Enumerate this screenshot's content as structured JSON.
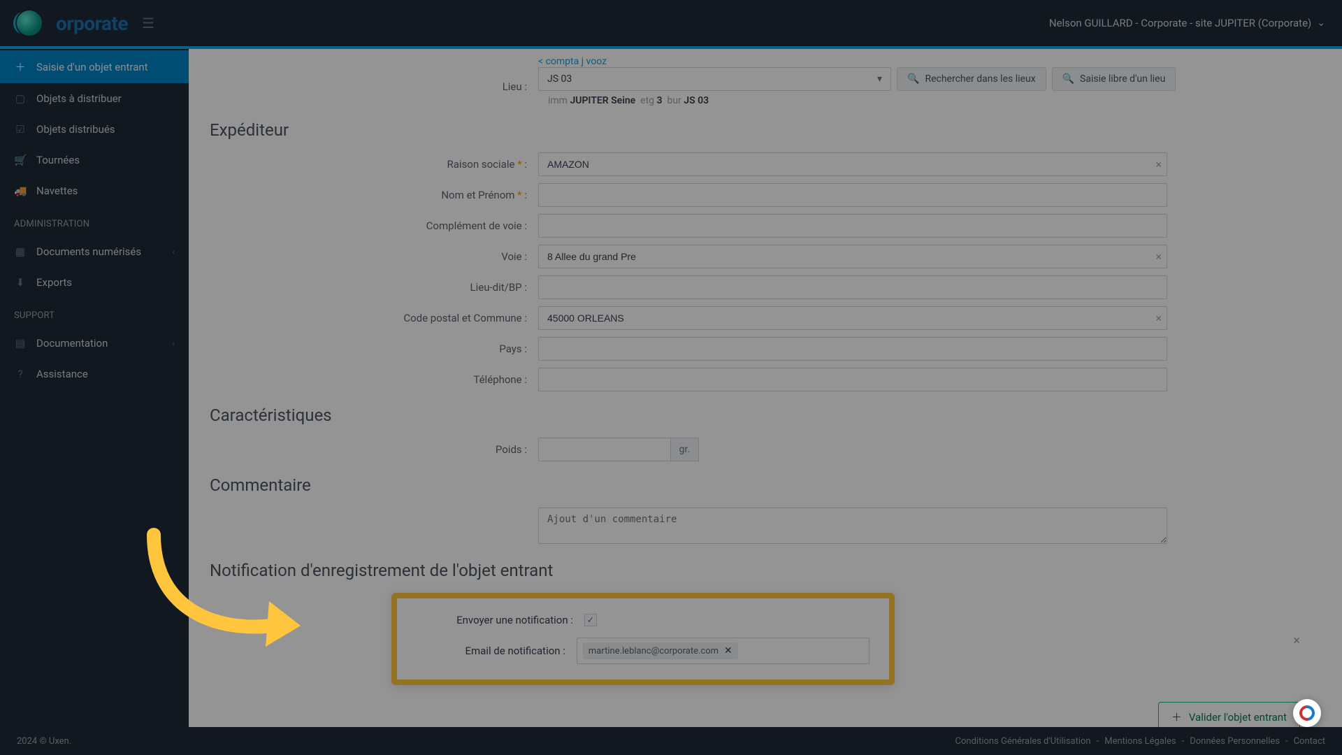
{
  "brand": {
    "name": "orporate"
  },
  "user": {
    "line": "Nelson GUILLARD - Corporate - site JUPITER (Corporate)"
  },
  "sidebar": {
    "items": [
      {
        "icon": "＋",
        "label": "Saisie d'un objet entrant",
        "active": true
      },
      {
        "icon": "▢",
        "label": "Objets à distribuer"
      },
      {
        "icon": "☑",
        "label": "Objets distribués"
      },
      {
        "icon": "🛒",
        "label": "Tournées"
      },
      {
        "icon": "🚚",
        "label": "Navettes"
      }
    ],
    "admin_header": "ADMINISTRATION",
    "admin_items": [
      {
        "icon": "▦",
        "label": "Documents numérisés",
        "sub": true
      },
      {
        "icon": "⬇",
        "label": "Exports"
      }
    ],
    "support_header": "SUPPORT",
    "support_items": [
      {
        "icon": "▤",
        "label": "Documentation",
        "sub": true
      },
      {
        "icon": "?",
        "label": "Assistance"
      }
    ]
  },
  "form": {
    "top_line": "< compta j vooz",
    "lieu": {
      "label": "Lieu :",
      "value": "JS 03"
    },
    "lieu_buttons": {
      "search": "Rechercher dans les lieux",
      "free": "Saisie libre d'un lieu"
    },
    "lieu_breadcrumb": {
      "imm_l": "imm",
      "imm_v": "JUPITER Seine",
      "etg_l": "etg",
      "etg_v": "3",
      "bur_l": "bur",
      "bur_v": "JS 03"
    },
    "sections": {
      "expediteur": "Expéditeur",
      "caracteristiques": "Caractéristiques",
      "commentaire": "Commentaire",
      "notification": "Notification d'enregistrement de l'objet entrant"
    },
    "exp": {
      "raison_label": "Raison sociale",
      "raison_value": "AMAZON",
      "nom_label": "Nom et Prénom",
      "compl_label": "Complément de voie :",
      "voie_label": "Voie :",
      "voie_value": "8 Allee du grand Pre",
      "lieudit_label": "Lieu-dit/BP :",
      "cp_label": "Code postal et Commune :",
      "cp_value": "45000 ORLEANS",
      "pays_label": "Pays :",
      "tel_label": "Téléphone :"
    },
    "carac": {
      "poids_label": "Poids :",
      "unit": "gr."
    },
    "comment_placeholder": "Ajout d'un commentaire",
    "notif": {
      "send_label": "Envoyer une notification :",
      "email_label": "Email de notification :",
      "chip": "martine.leblanc@corporate.com"
    },
    "validate": "Valider l'objet entrant"
  },
  "footer": {
    "left": "2024 © Uxen.",
    "links": [
      "Conditions Générales d'Utilisation",
      "Mentions Légales",
      "Données Personnelles",
      "Contact"
    ]
  }
}
